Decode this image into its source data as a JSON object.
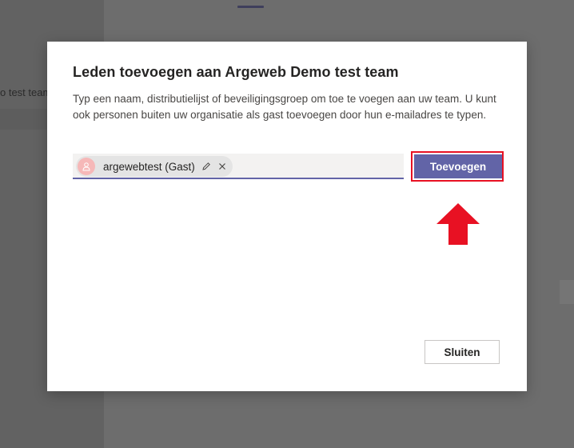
{
  "background": {
    "left_item_text": "o test team"
  },
  "dialog": {
    "title": "Leden toevoegen aan Argeweb Demo test team",
    "description": "Typ een naam, distributielijst of beveiligingsgroep om toe te voegen aan uw team. U kunt ook personen buiten uw organisatie als gast toevoegen door hun e-mailadres te typen.",
    "chip": {
      "label": "argewebtest (Gast)",
      "avatar_icon": "person-icon",
      "edit_icon": "pencil-icon",
      "remove_icon": "close-icon"
    },
    "add_button_label": "Toevoegen",
    "close_button_label": "Sluiten"
  },
  "colors": {
    "accent": "#6264a7",
    "highlight": "#e81123"
  }
}
